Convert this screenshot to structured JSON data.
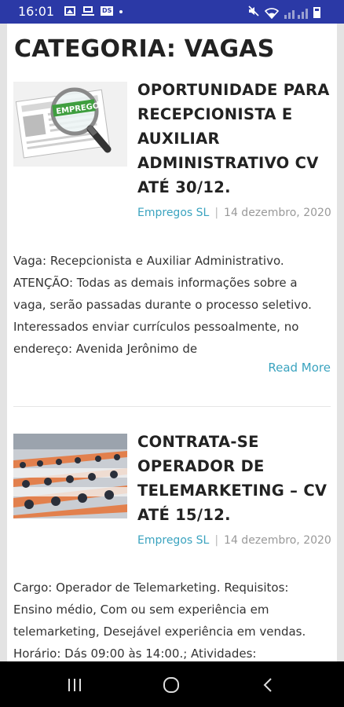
{
  "status_bar": {
    "time": "16:01",
    "icons_left": [
      "photo-icon",
      "laptop-icon",
      "badge-icon",
      "dot-icon"
    ],
    "icons_right": [
      "mute-icon",
      "wifi-icon",
      "signal-icon",
      "battery-icon"
    ],
    "background": "#2b39a6"
  },
  "page": {
    "category_title": "CATEGORIA: VAGAS"
  },
  "posts": [
    {
      "title": "OPORTUNIDADE PARA RECEPCIONISTA E AUXILIAR ADMINISTRATIVO CV ATÉ 30/12.",
      "author": "Empregos SL",
      "separator": "|",
      "date": "14 dezembro, 2020",
      "excerpt": "Vaga: Recepcionista e Auxiliar Administrativo. ATENÇÃO: Todas as demais informações sobre a vaga, serão passadas durante o processo seletivo. Interessados enviar currículos pessoalmente, no endereço: Avenida Jerônimo de",
      "read_more": "Read More",
      "thumbnail_label": "EMPREGO"
    },
    {
      "title": "CONTRATA-SE OPERADOR DE TELEMARKETING – CV ATÉ 15/12.",
      "author": "Empregos SL",
      "separator": "|",
      "date": "14 dezembro, 2020",
      "excerpt": "Cargo: Operador de Telemarketing. Requisitos: Ensino médio, Com ou sem experiência em telemarketing, Desejável experiência em vendas. Horário: Dás 09:00 às 14:00.; Atividades:"
    }
  ],
  "colors": {
    "accent": "#3aa3bf",
    "title": "#222222",
    "nav_bar": "#000000"
  },
  "nav_bar": {
    "buttons": [
      "recents-icon",
      "home-icon",
      "back-icon"
    ]
  }
}
